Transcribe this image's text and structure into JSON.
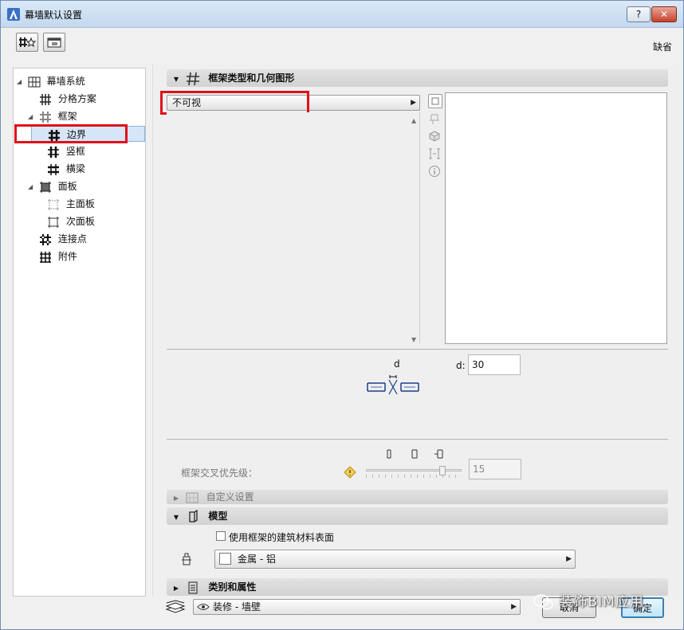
{
  "window": {
    "title": "幕墙默认设置",
    "help_label": "?",
    "close_label": "✕"
  },
  "toolbar": {
    "default_label": "缺省"
  },
  "tree": {
    "items": [
      {
        "label": "幕墙系统",
        "icon": "curtain-wall-icon"
      },
      {
        "label": "分格方案",
        "icon": "grid-scheme-icon"
      },
      {
        "label": "框架",
        "icon": "frame-icon"
      },
      {
        "label": "边界",
        "icon": "frame-boundary-icon"
      },
      {
        "label": "竖框",
        "icon": "mullion-icon"
      },
      {
        "label": "横梁",
        "icon": "transom-icon"
      },
      {
        "label": "面板",
        "icon": "panel-icon"
      },
      {
        "label": "主面板",
        "icon": "main-panel-icon"
      },
      {
        "label": "次面板",
        "icon": "secondary-panel-icon"
      },
      {
        "label": "连接点",
        "icon": "junction-icon"
      },
      {
        "label": "附件",
        "icon": "accessory-icon"
      }
    ]
  },
  "frame_section": {
    "title": "框架类型和几何图形",
    "frame_type": "不可视",
    "d_label": "d",
    "d_field_label": "d:",
    "d_value": "30",
    "priority_label": "框架交叉优先级：",
    "priority_value": "15"
  },
  "custom_section": {
    "title": "自定义设置"
  },
  "model_section": {
    "title": "模型",
    "use_material_label": "使用框架的建筑材料表面",
    "use_material_checked": false,
    "material": "金属 - 铝"
  },
  "category_section": {
    "title": "类别和属性"
  },
  "footer": {
    "layer": "装修 - 墙壁",
    "cancel_label": "取消",
    "ok_label": "确定"
  },
  "watermark": {
    "text": "装饰BIM应用"
  },
  "colors": {
    "highlight": "#e0101a",
    "selection": "#d6e6f8",
    "accent": "#3c7fb1"
  }
}
